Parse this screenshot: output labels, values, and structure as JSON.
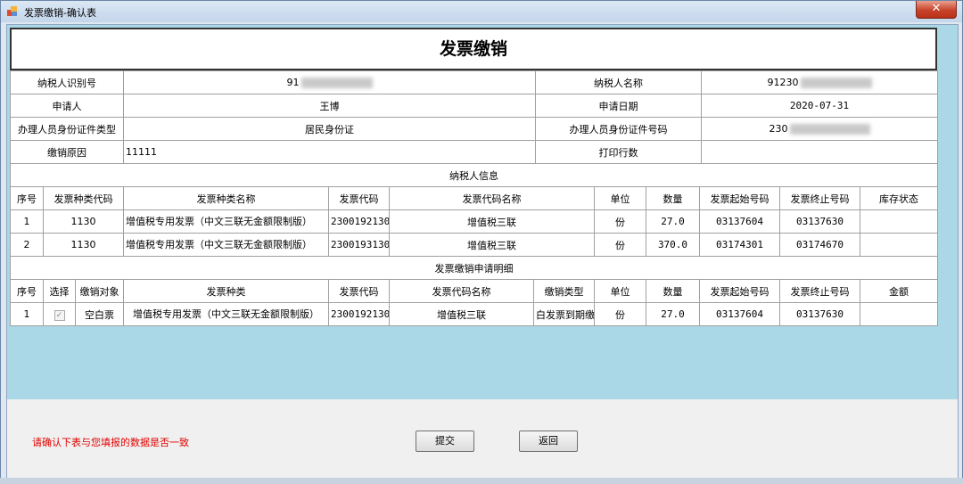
{
  "window": {
    "title": "发票缴销-确认表",
    "close_glyph": "✕"
  },
  "form": {
    "title": "发票缴销",
    "taxpayer_id_label": "纳税人识别号",
    "taxpayer_id_value": "91",
    "taxpayer_name_label": "纳税人名称",
    "taxpayer_name_value": "91230",
    "applicant_label": "申请人",
    "applicant_value": "王博",
    "apply_date_label": "申请日期",
    "apply_date_value": "2020-07-31",
    "id_type_label": "办理人员身份证件类型",
    "id_type_value": "居民身份证",
    "id_number_label": "办理人员身份证件号码",
    "id_number_value": "230",
    "reason_label": "缴销原因",
    "reason_value": "11111",
    "print_rows_label": "打印行数",
    "print_rows_value": ""
  },
  "taxpayer_info": {
    "section_title": "纳税人信息",
    "headers": [
      "序号",
      "发票种类代码",
      "发票种类名称",
      "发票代码",
      "发票代码名称",
      "单位",
      "数量",
      "发票起始号码",
      "发票终止号码",
      "库存状态"
    ],
    "rows": [
      [
        "1",
        "1130",
        "增值税专用发票（中文三联无金额限制版）",
        "2300192130",
        "增值税三联",
        "份",
        "27.0",
        "03137604",
        "03137630",
        ""
      ],
      [
        "2",
        "1130",
        "增值税专用发票（中文三联无金额限制版）",
        "2300193130",
        "增值税三联",
        "份",
        "370.0",
        "03174301",
        "03174670",
        ""
      ]
    ]
  },
  "cancel_detail": {
    "section_title": "发票缴销申请明细",
    "headers": [
      "序号",
      "选择",
      "缴销对象",
      "发票种类",
      "发票代码",
      "发票代码名称",
      "缴销类型",
      "单位",
      "数量",
      "发票起始号码",
      "发票终止号码",
      "金额"
    ],
    "rows": [
      [
        "1",
        "",
        "空白票",
        "增值税专用发票（中文三联无金额限制版）",
        "2300192130",
        "增值税三联",
        "白发票到期缴",
        "份",
        "27.0",
        "03137604",
        "03137630",
        ""
      ]
    ],
    "checkbox_glyph": "✓"
  },
  "footer": {
    "notice": "请确认下表与您填报的数据是否一致",
    "submit_label": "提交",
    "back_label": "返回"
  },
  "colors": {
    "panel_bg": "#abd8e6",
    "notice_text": "#e00000",
    "close_button": "#c8432b"
  }
}
